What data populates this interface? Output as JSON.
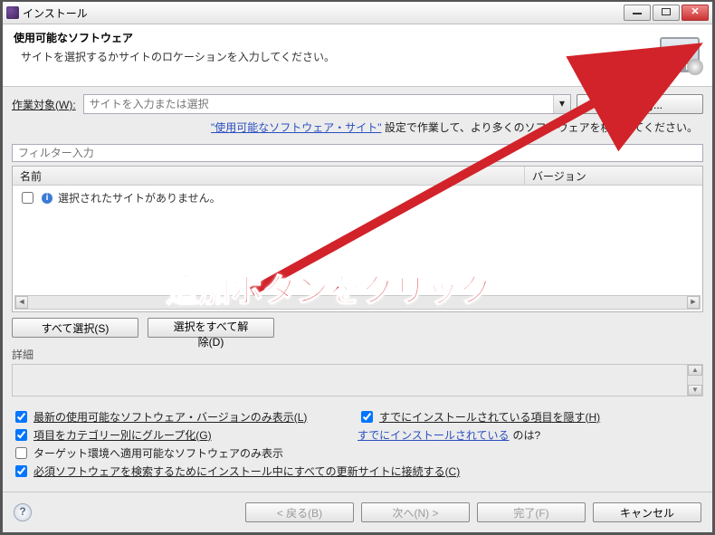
{
  "titlebar": {
    "title": "インストール"
  },
  "header": {
    "heading": "使用可能なソフトウェア",
    "sub": "サイトを選択するかサイトのロケーションを入力してください。"
  },
  "worksite": {
    "label": "作業対象(W):",
    "placeholder": "サイトを入力または選択",
    "add_button": "追加(A)..."
  },
  "hint": {
    "link_text": "\"使用可能なソフトウェア・サイト\"",
    "suffix": " 設定で作業して、より多くのソフトウェアを検索してください。"
  },
  "filter": {
    "placeholder": "フィルター入力"
  },
  "table": {
    "col_name": "名前",
    "col_version": "バージョン",
    "empty_message": "選択されたサイトがありません。"
  },
  "buttons": {
    "select_all": "すべて選択(S)",
    "deselect_all": "選択をすべて解除(D)"
  },
  "detail_label": "詳細",
  "options": {
    "latest_only": {
      "checked": true,
      "label": "最新の使用可能なソフトウェア・バージョンのみ表示(L)"
    },
    "hide_installed": {
      "checked": true,
      "label": "すでにインストールされている項目を隠す(H)"
    },
    "group_cat": {
      "checked": true,
      "label": "項目をカテゴリー別にグループ化(G)"
    },
    "already_link": {
      "link": "すでにインストールされている",
      "suffix": " のは?"
    },
    "target_env": {
      "checked": false,
      "label": "ターゲット環境へ適用可能なソフトウェアのみ表示"
    },
    "required": {
      "checked": true,
      "label": "必須ソフトウェアを検索するためにインストール中にすべての更新サイトに接続する(C)"
    }
  },
  "footer": {
    "back": "< 戻る(B)",
    "next": "次へ(N) >",
    "finish": "完了(F)",
    "cancel": "キャンセル"
  },
  "overlay": {
    "text": "追加ボタンをクリック"
  }
}
